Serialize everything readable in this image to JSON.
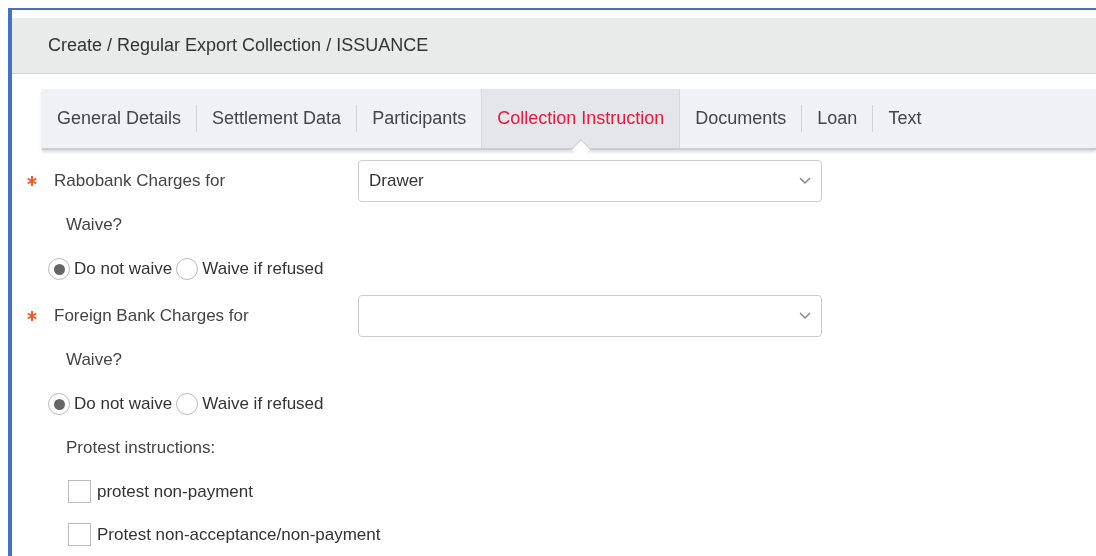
{
  "breadcrumb": "Create / Regular Export Collection / ISSUANCE",
  "tabs": [
    {
      "label": "General Details",
      "selected": false
    },
    {
      "label": "Settlement Data",
      "selected": false
    },
    {
      "label": "Participants",
      "selected": false
    },
    {
      "label": "Collection Instruction",
      "selected": true
    },
    {
      "label": "Documents",
      "selected": false
    },
    {
      "label": "Loan",
      "selected": false
    },
    {
      "label": "Text",
      "selected": false
    }
  ],
  "form": [
    {
      "kind": "select",
      "label": "Rabobank Charges for",
      "required": true,
      "value": "Drawer"
    },
    {
      "kind": "label",
      "label": "Waive?"
    },
    {
      "kind": "radios",
      "options": [
        {
          "label": "Do not waive",
          "selected": true
        },
        {
          "label": "Waive if refused",
          "selected": false
        }
      ]
    },
    {
      "kind": "select",
      "label": "Foreign Bank Charges for",
      "required": true
    },
    {
      "kind": "label",
      "label": "Waive?"
    },
    {
      "kind": "radios",
      "options": [
        {
          "label": "Do not waive",
          "selected": true
        },
        {
          "label": "Waive if refused",
          "selected": false
        }
      ]
    },
    {
      "kind": "label",
      "label": "Protest instructions:"
    },
    {
      "kind": "checkbox",
      "label": "protest non-payment",
      "checked": false
    },
    {
      "kind": "checkbox",
      "label": "Protest non-acceptance/non-payment",
      "checked": false
    }
  ]
}
